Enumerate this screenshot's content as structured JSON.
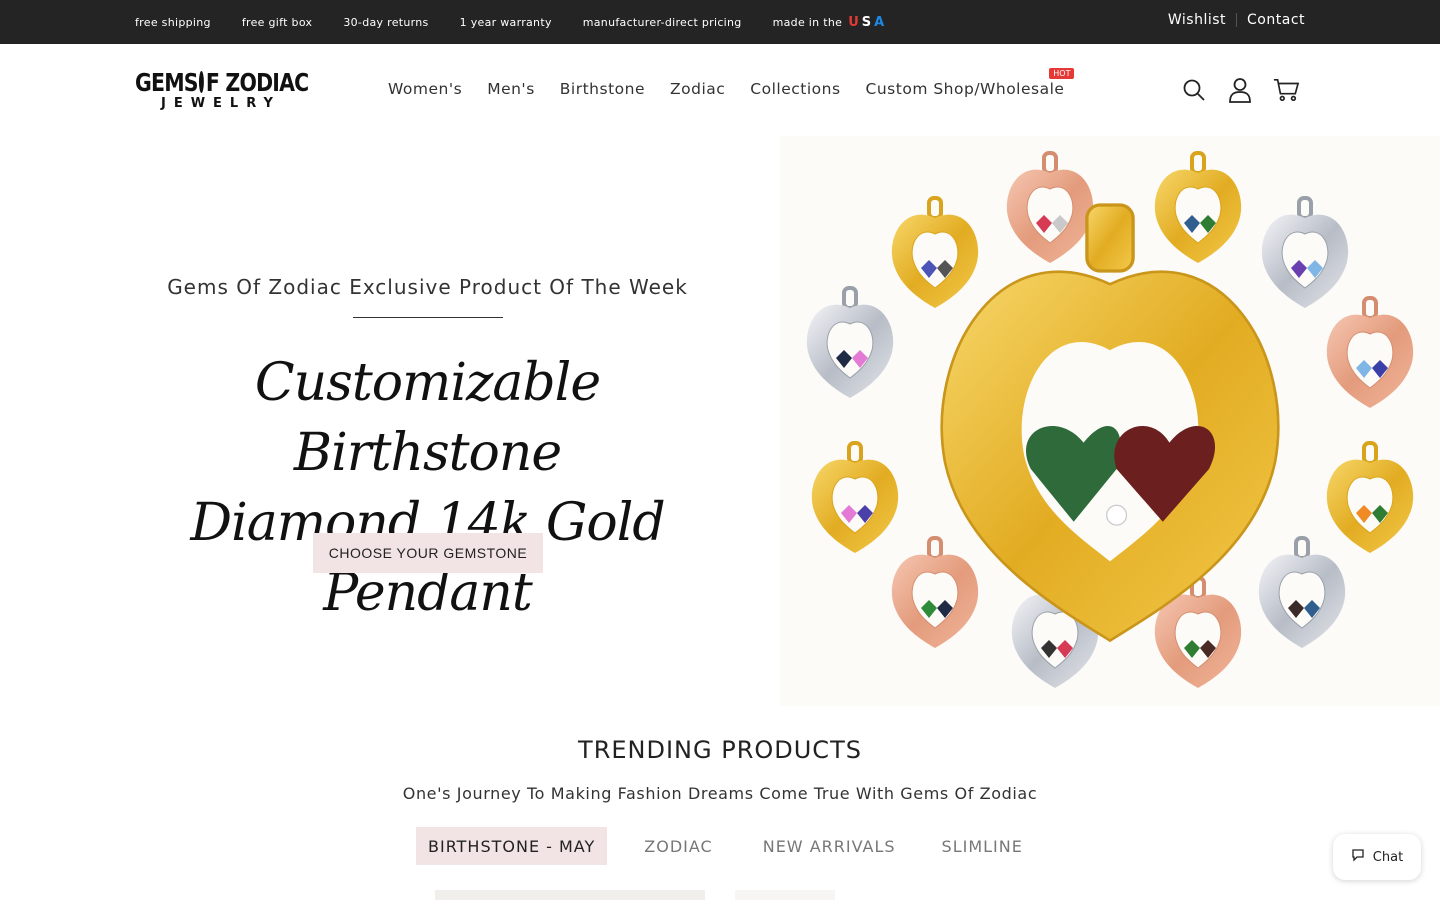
{
  "topbar": {
    "perks": [
      "free shipping",
      "free gift box",
      "30-day returns",
      "1 year warranty",
      "manufacturer-direct pricing",
      "made in the"
    ],
    "usa_letters": [
      "U",
      "S",
      "A"
    ],
    "usa_colors": [
      "#e53935",
      "#ffffff",
      "#1e88e5"
    ],
    "wishlist": "Wishlist",
    "contact": "Contact"
  },
  "logo": {
    "line1_left": "GEMS",
    "line1_right": "F ZODIAC",
    "line2": "JEWELRY"
  },
  "nav": {
    "items": [
      "Women's",
      "Men's",
      "Birthstone",
      "Zodiac",
      "Collections",
      "Custom Shop/Wholesale"
    ],
    "hot_badge": "HOT"
  },
  "icons": [
    "search-icon",
    "account-icon",
    "cart-icon"
  ],
  "hero": {
    "kicker": "Gems Of Zodiac Exclusive Product Of The Week",
    "title_line1": "Customizable Birthstone",
    "title_line2": "Diamond 14k Gold Pendant",
    "cta": "CHOOSE YOUR GEMSTONE"
  },
  "trending": {
    "title": "TRENDING PRODUCTS",
    "subtitle": "One's Journey To Making Fashion Dreams Come True With Gems Of Zodiac",
    "tabs": [
      {
        "label": "BIRTHSTONE - MAY",
        "active": true
      },
      {
        "label": "ZODIAC",
        "active": false
      },
      {
        "label": "NEW ARRIVALS",
        "active": false
      },
      {
        "label": "SLIMLINE",
        "active": false
      }
    ]
  },
  "chat": {
    "label": "Chat"
  },
  "colors": {
    "topbar_bg": "#242424",
    "accent_pink": "#f2e4e4",
    "gold": "#e8b830",
    "rose": "#e8a88c",
    "silver": "#c9ccd3"
  }
}
